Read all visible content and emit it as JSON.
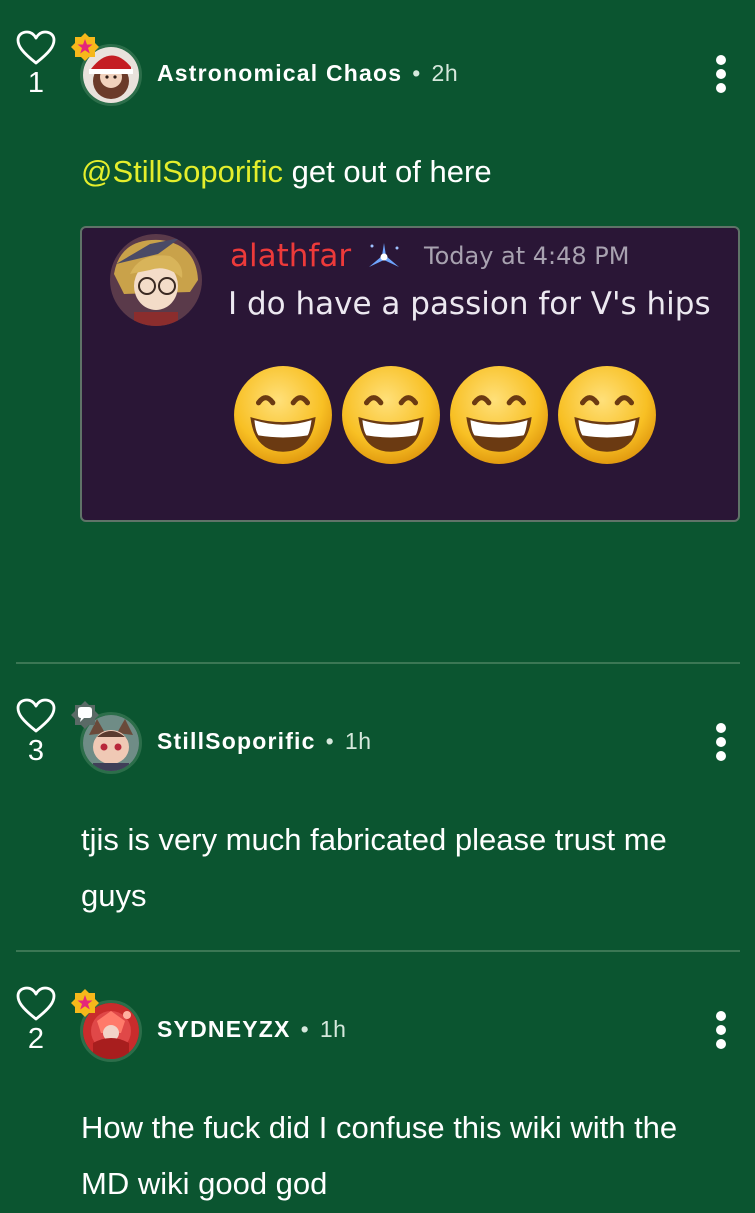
{
  "comments": [
    {
      "likes": "1",
      "author": "Astronomical Chaos",
      "separator": "•",
      "time": "2h",
      "mention": "@StillSoporific",
      "text": " get out of here",
      "badge": "star-badge-icon"
    },
    {
      "likes": "3",
      "author": "StillSoporific",
      "separator": "•",
      "time": "1h",
      "text": "tjis is very much fabricated please trust me guys",
      "badge": "chat-bubble-badge-icon"
    },
    {
      "likes": "2",
      "author": "SYDNEYZX",
      "separator": "•",
      "time": "1h",
      "text": "How the fuck did I confuse this wiki with the MD wiki good god",
      "badge": "star-badge-icon"
    }
  ],
  "embed": {
    "username": "alathfar",
    "timestamp": "Today at 4:48 PM",
    "message": "I do have a passion for V's hips",
    "emoji_count": 4,
    "emoji_icon": "grinning-face-with-smiling-eyes-icon"
  },
  "colors": {
    "background": "#0b5530",
    "mention": "#e4ee2c",
    "embed_background": "#2a1636",
    "embed_username": "#ed3a3a",
    "divider": "#3b7754"
  }
}
